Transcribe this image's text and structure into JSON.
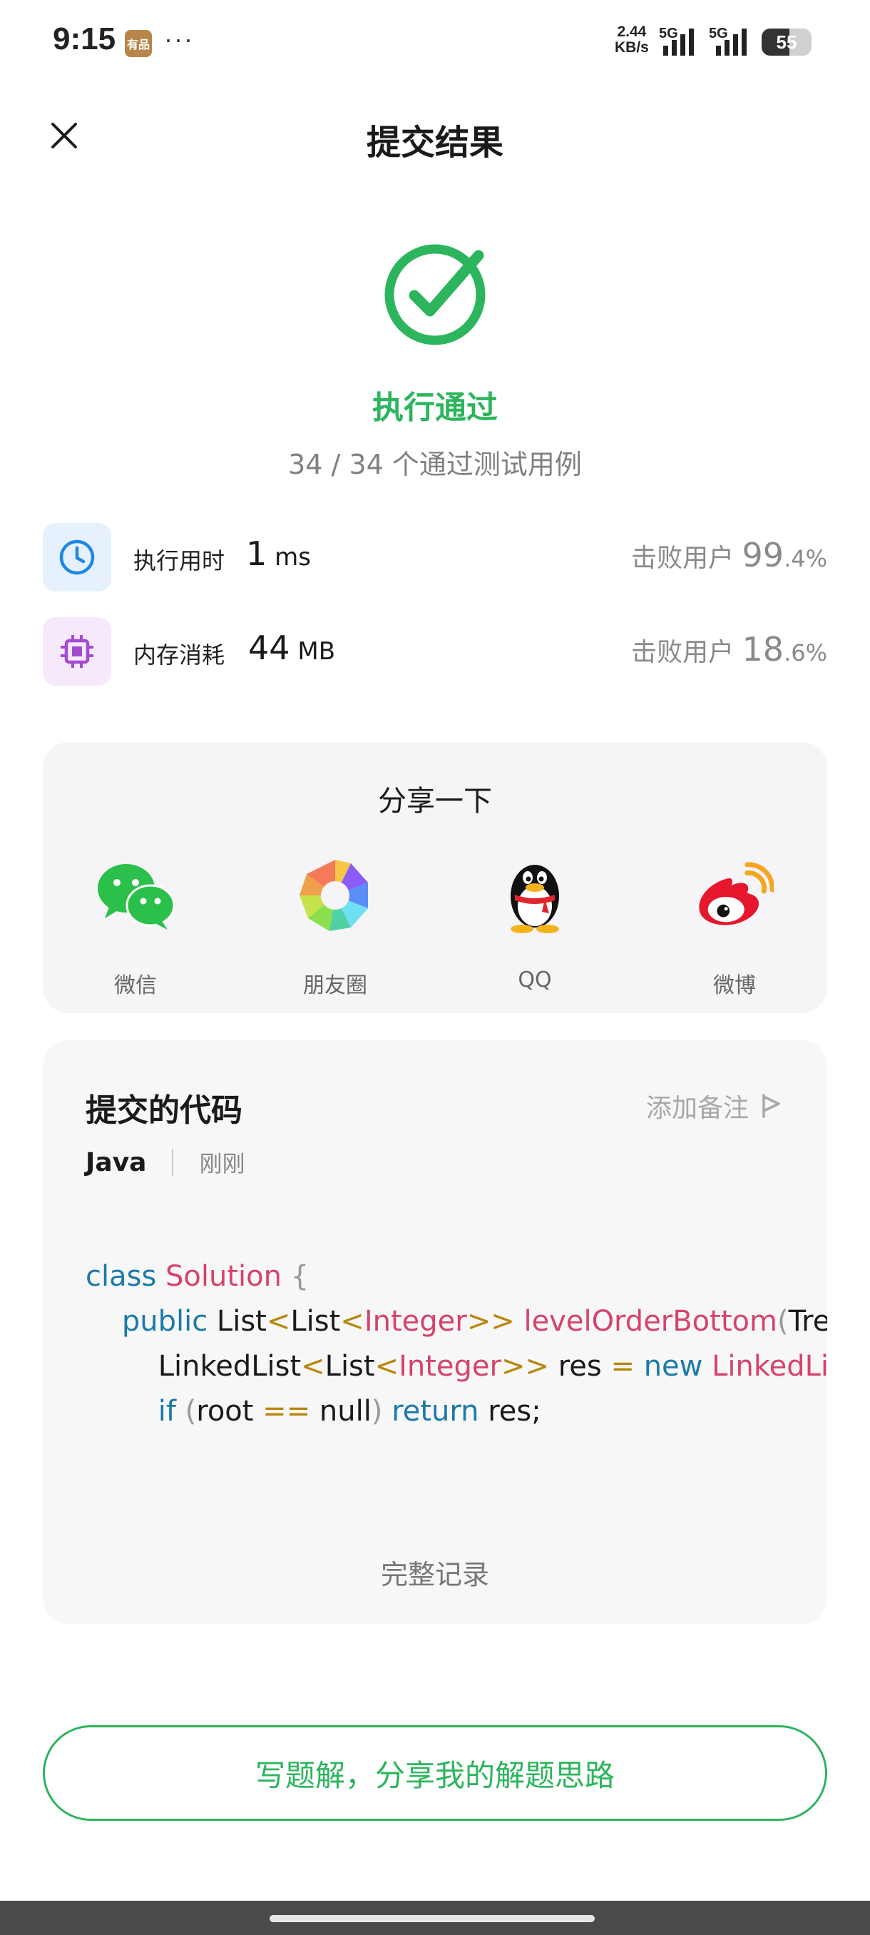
{
  "status_bar": {
    "time": "9:15",
    "app_badge": "有品",
    "dots": "···",
    "speed_value": "2.44",
    "speed_unit": "KB/s",
    "network_1": "5G",
    "network_2": "5G",
    "battery": "55",
    "battery_level_percent": 55
  },
  "header": {
    "title": "提交结果"
  },
  "result": {
    "status": "执行通过",
    "cases": "34 / 34 个通过测试用例",
    "accent_color": "#2db55d"
  },
  "stats": [
    {
      "icon": "clock-icon",
      "label": "执行用时",
      "value": "1",
      "unit": " ms",
      "beat_prefix": "击败用户 ",
      "beat_int": "99",
      "beat_frac": ".4%"
    },
    {
      "icon": "chip-icon",
      "label": "内存消耗",
      "value": "44",
      "unit": " MB",
      "beat_prefix": "击败用户 ",
      "beat_int": "18",
      "beat_frac": ".6%"
    }
  ],
  "share": {
    "title": "分享一下",
    "items": [
      {
        "label": "微信",
        "icon": "wechat-icon"
      },
      {
        "label": "朋友圈",
        "icon": "moments-icon"
      },
      {
        "label": "QQ",
        "icon": "qq-icon"
      },
      {
        "label": "微博",
        "icon": "weibo-icon"
      }
    ]
  },
  "code": {
    "title": "提交的代码",
    "add_note": "添加备注",
    "language": "Java",
    "time": "刚刚",
    "full_record": "完整记录",
    "lines": [
      "class Solution {",
      "    public List<List<Integer>> levelOrderBottom(TreeN",
      "        LinkedList<List<Integer>> res = new LinkedList<>",
      "        if (root == null) return res;"
    ]
  },
  "actions": {
    "write_solution": "写题解，分享我的解题思路"
  }
}
